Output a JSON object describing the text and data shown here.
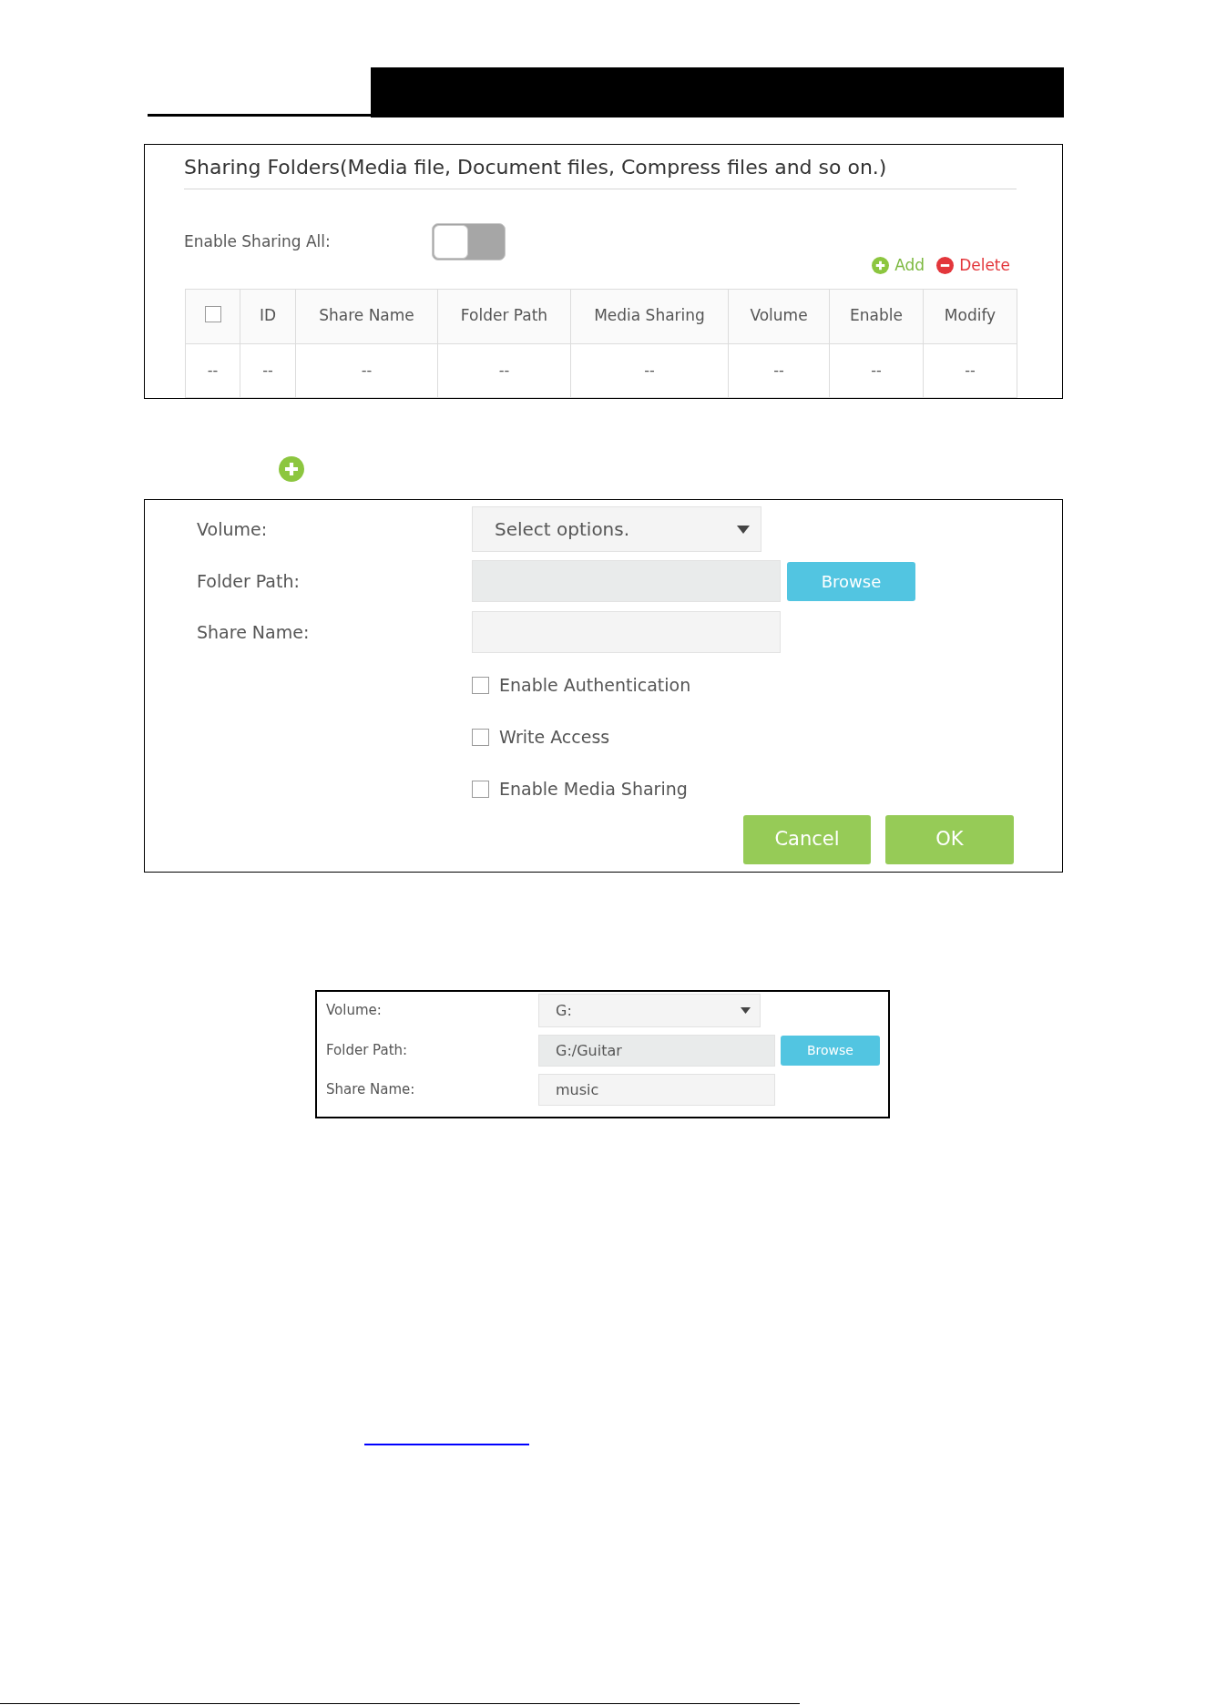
{
  "sharing_panel": {
    "title": "Sharing Folders(Media file, Document files, Compress files and so on.)",
    "enable_sharing_all": {
      "label": "Enable Sharing All:",
      "on": false
    },
    "actions": [
      {
        "kind": "add",
        "label": "Add"
      },
      {
        "kind": "delete",
        "label": "Delete"
      }
    ],
    "table": {
      "columns": [
        {
          "kind": "checkbox",
          "checked": false
        },
        {
          "kind": "text",
          "label": "ID"
        },
        {
          "kind": "text",
          "label": "Share Name"
        },
        {
          "kind": "text",
          "label": "Folder Path"
        },
        {
          "kind": "text",
          "label": "Media Sharing"
        },
        {
          "kind": "text",
          "label": "Volume"
        },
        {
          "kind": "text",
          "label": "Enable"
        },
        {
          "kind": "text",
          "label": "Modify"
        }
      ],
      "rows": [
        [
          "--",
          "--",
          "--",
          "--",
          "--",
          "--",
          "--",
          "--"
        ]
      ]
    }
  },
  "add_dialog": {
    "fields": [
      {
        "kind": "select",
        "label": "Volume:",
        "placeholder": "Select options."
      },
      {
        "kind": "path",
        "label": "Folder Path:",
        "button": "Browse"
      },
      {
        "kind": "text",
        "label": "Share Name:"
      }
    ],
    "options": [
      {
        "label": "Enable Authentication",
        "checked": false
      },
      {
        "label": "Write Access",
        "checked": false
      },
      {
        "label": "Enable Media Sharing",
        "checked": false
      }
    ],
    "buttons": [
      {
        "kind": "cancel",
        "label": "Cancel"
      },
      {
        "kind": "ok",
        "label": "OK"
      }
    ]
  },
  "example_dialog": {
    "fields": [
      {
        "kind": "select",
        "label": "Volume:",
        "value": "G:"
      },
      {
        "kind": "path",
        "label": "Folder Path:",
        "value": "G:/Guitar",
        "button": "Browse"
      },
      {
        "kind": "text",
        "label": "Share Name:",
        "value": "music"
      }
    ]
  }
}
